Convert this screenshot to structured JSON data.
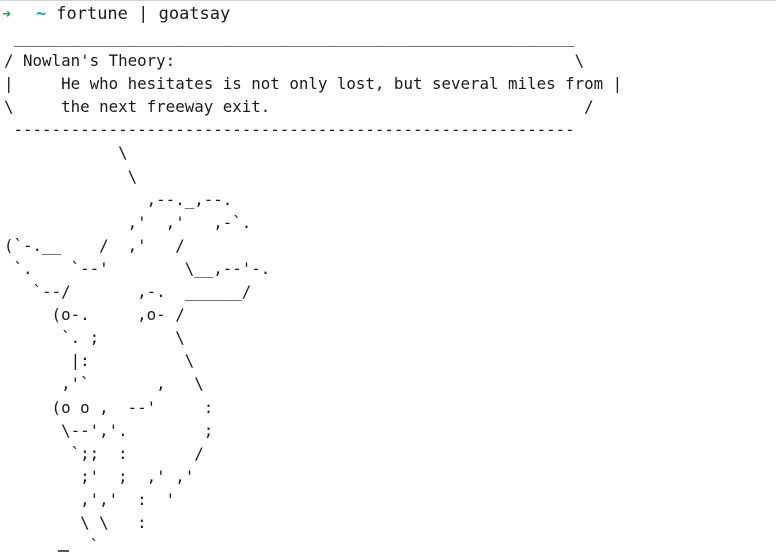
{
  "prompt": {
    "arrow": "➜",
    "directory": "~",
    "command": "fortune | goatsay"
  },
  "output": {
    "lines": [
      " ___________________________________________________________",
      "/ Nowlan's Theory:                                          \\",
      "|     He who hesitates is not only lost, but several miles from |",
      "\\     the next freeway exit.                                 /",
      " -----------------------------------------------------------",
      "            \\",
      "             \\",
      "               ,--._,--.",
      "             ,'  ,'   ,-`.",
      "(`-.__    /  ,'   /",
      " `.    `--'        \\__,--'-.",
      "   `--/       ,-.  ______/",
      "     (o-.     ,o- /",
      "      `. ;        \\",
      "       |:          \\",
      "      ,'`       ,   \\",
      "     (o o ,  --'     :",
      "      \\--','.        ;",
      "       `;;  :       /",
      "        ;'  ;  ,' ,'",
      "        ,','  :  '",
      "        \\ \\   :",
      "         `"
    ]
  },
  "colors": {
    "arrow": "#2a9d4a",
    "tilde": "#1fa3a3",
    "text": "#1a1a1a",
    "background": "#ffffff"
  }
}
